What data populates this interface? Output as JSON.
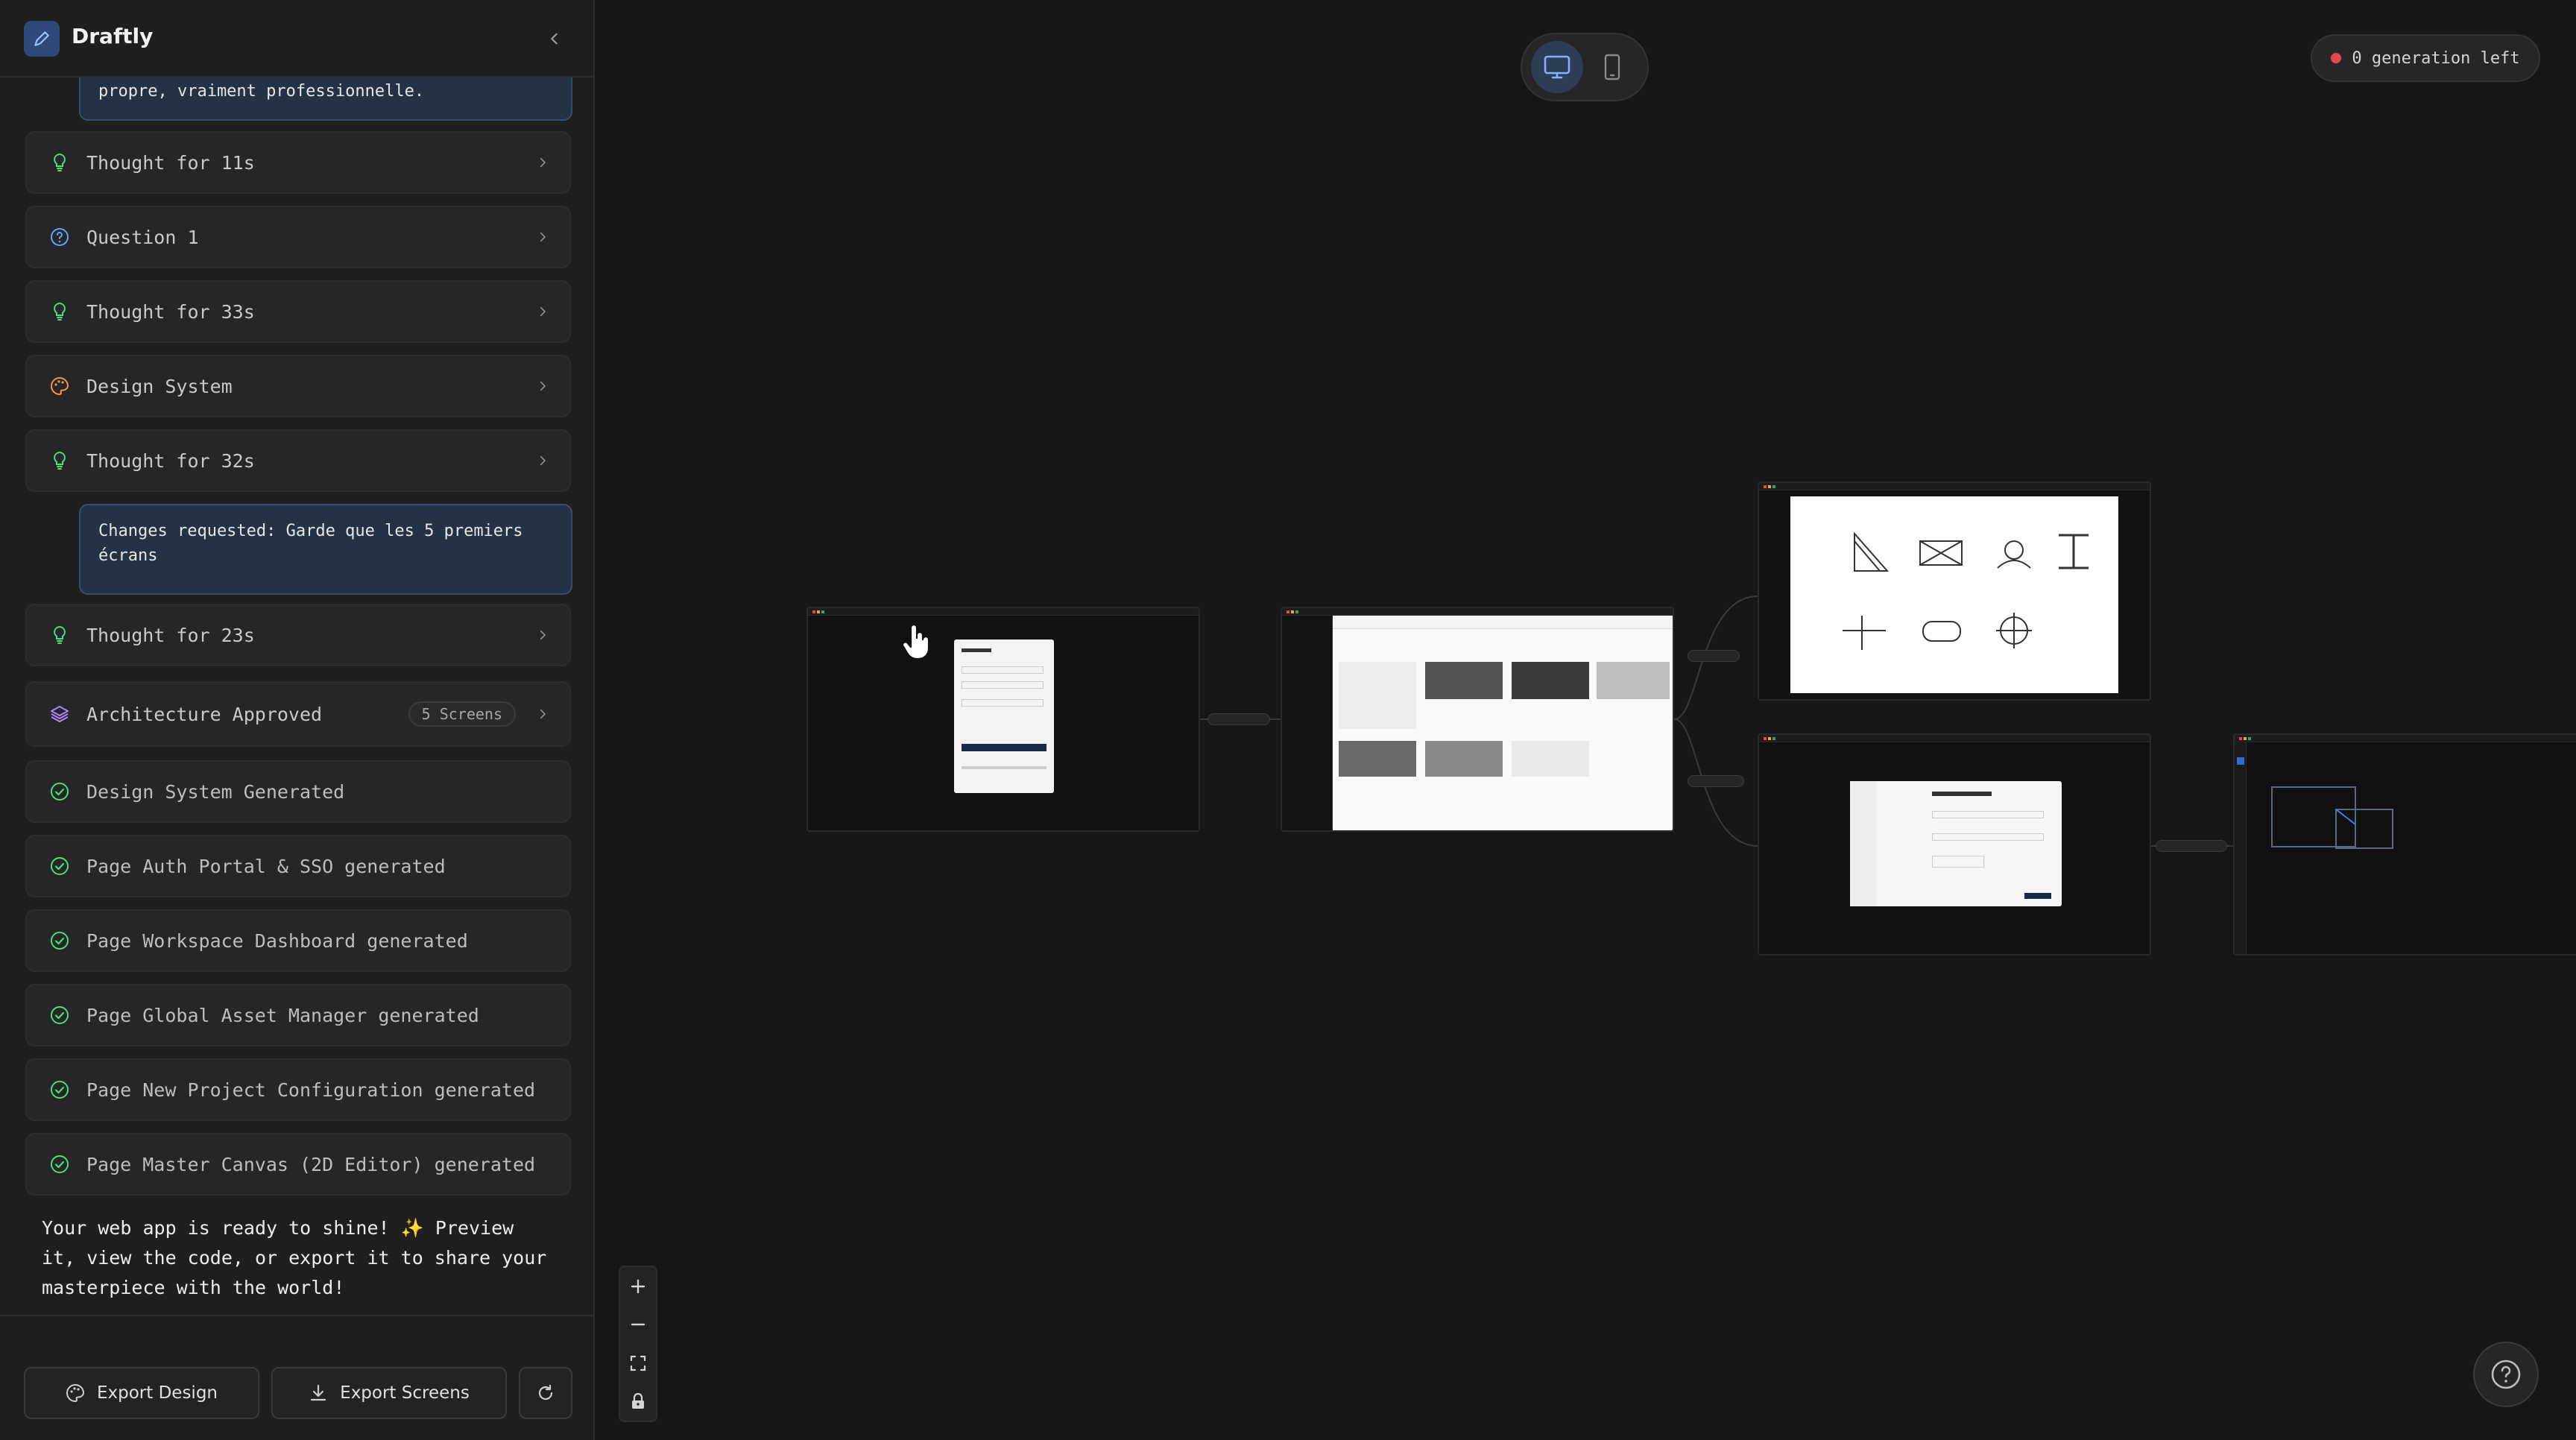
{
  "app": {
    "title": "Draftly"
  },
  "sidebar": {
    "top_bubble_text": "propre, vraiment professionnelle.",
    "items": [
      {
        "label": "Thought for 11s",
        "icon": "lightbulb-icon"
      },
      {
        "label": "Question 1",
        "icon": "question-circle-icon"
      },
      {
        "label": "Thought for 33s",
        "icon": "lightbulb-icon"
      },
      {
        "label": "Design System",
        "icon": "palette-icon"
      },
      {
        "label": "Thought for 32s",
        "icon": "lightbulb-icon"
      }
    ],
    "changes_bubble": "Changes requested: Garde que les 5 premiers écrans",
    "items2": [
      {
        "label": "Thought for 23s",
        "icon": "lightbulb-icon"
      },
      {
        "label": "Architecture Approved",
        "icon": "layers-icon",
        "badge": "5 Screens"
      }
    ],
    "done_items": [
      {
        "label": "Design System Generated"
      },
      {
        "label": "Page Auth Portal & SSO generated"
      },
      {
        "label": "Page Workspace Dashboard generated"
      },
      {
        "label": "Page Global Asset Manager generated"
      },
      {
        "label": "Page New Project Configuration generated"
      },
      {
        "label": "Page Master Canvas (2D Editor) generated"
      }
    ],
    "final_message": "Your web app is ready to shine! ✨ Preview it, view the code, or export it to share your masterpiece with the world!",
    "footer": {
      "export_design": "Export Design",
      "export_screens": "Export Screens"
    }
  },
  "canvas": {
    "generation_status": "0 generation left",
    "device_modes": [
      "desktop",
      "mobile"
    ],
    "active_device": "desktop"
  },
  "colors": {
    "accent": "#60a5fa",
    "thought_green": "#4ade80",
    "question_blue": "#60a5fa",
    "palette_orange": "#fb923c",
    "layers_purple": "#a78bfa",
    "status_red": "#e5484d"
  }
}
